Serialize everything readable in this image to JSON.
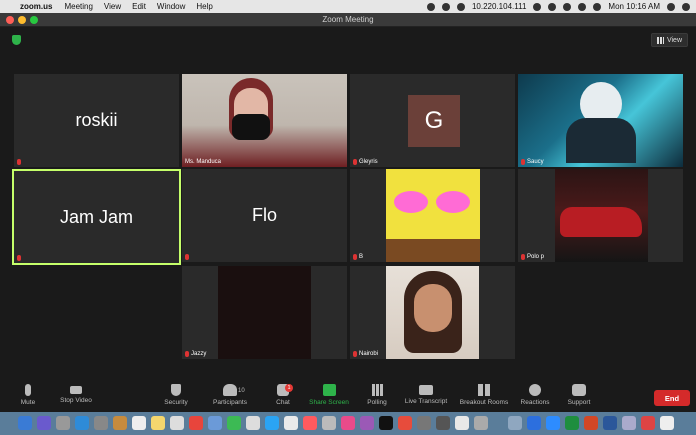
{
  "menubar": {
    "app": "zoom.us",
    "items": [
      "Meeting",
      "View",
      "Edit",
      "Window",
      "Help"
    ],
    "ip": "10.220.104.111",
    "clock": "Mon 10:16 AM"
  },
  "window": {
    "title": "Zoom Meeting"
  },
  "view_button": "View",
  "participants": [
    {
      "name": "roskii",
      "big": "roskii",
      "type": "name"
    },
    {
      "name": "Ms. Manduca",
      "type": "video"
    },
    {
      "name": "Gleyris",
      "initial": "G",
      "type": "avatar"
    },
    {
      "name": "Saucy",
      "type": "image"
    },
    {
      "name": "Jam Jam",
      "big": "Jam Jam",
      "type": "name",
      "active": true
    },
    {
      "name": "Flo",
      "big": "Flo",
      "type": "name"
    },
    {
      "name": "B",
      "type": "image"
    },
    {
      "name": "Polo p",
      "type": "image"
    },
    {
      "name": "Jazzy",
      "type": "video"
    },
    {
      "name": "Nairobi",
      "type": "video"
    }
  ],
  "toolbar": {
    "mute": "Mute",
    "stop_video": "Stop Video",
    "security": "Security",
    "participants": "Participants",
    "participants_count": "10",
    "chat": "Chat",
    "chat_badge": "1",
    "share": "Share Screen",
    "polling": "Polling",
    "live_transcript": "Live Transcript",
    "breakout": "Breakout Rooms",
    "reactions": "Reactions",
    "support": "Support",
    "end": "End"
  },
  "colors": {
    "active_border": "#c5ff6a",
    "end_red": "#d42a2a",
    "share_green": "#2eb34a"
  }
}
